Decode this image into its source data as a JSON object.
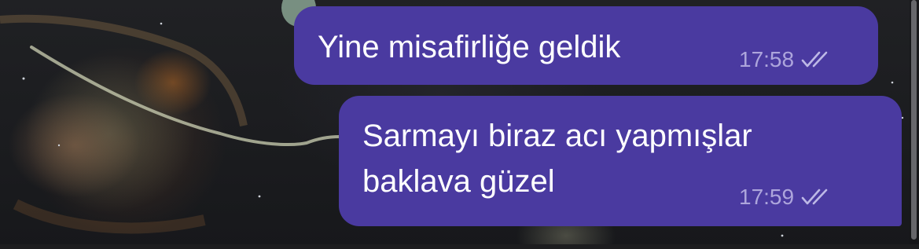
{
  "messages": [
    {
      "text": "Yine misafirliğe geldik",
      "time": "17:58",
      "status_icon": "double-check-icon"
    },
    {
      "text": "Sarmayı biraz acı yapmışlar\nbaklava güzel",
      "time": "17:59",
      "status_icon": "double-check-icon"
    }
  ],
  "colors": {
    "bubble": "#4a3aa0",
    "meta_text": "#bdb8e6",
    "background": "#1c1c1f"
  }
}
